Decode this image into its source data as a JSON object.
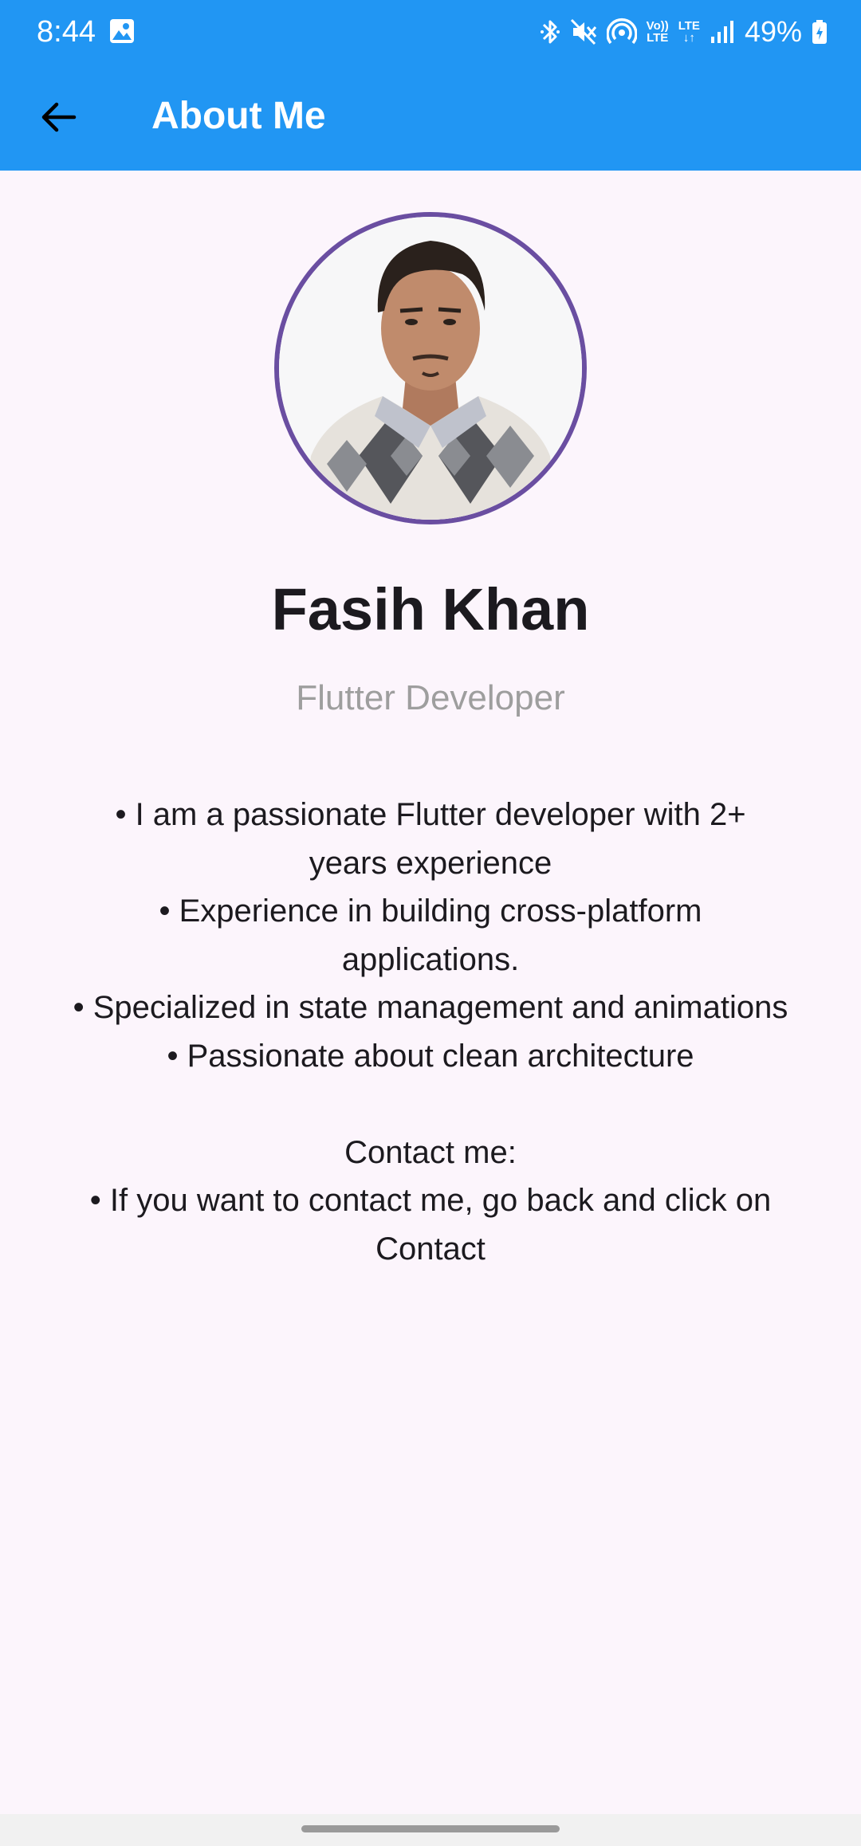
{
  "status_bar": {
    "time": "8:44",
    "volte_top": "Vo))",
    "volte_bottom": "LTE",
    "lte_label": "LTE",
    "battery_percent": "49%",
    "icons": [
      "gallery-icon",
      "bluetooth-icon",
      "vibrate-mute-icon",
      "hotspot-icon",
      "volte-icon",
      "lte-data-icon",
      "signal-icon",
      "battery-charging-icon"
    ]
  },
  "app_bar": {
    "title": "About Me",
    "back_icon": "arrow-back-icon",
    "background": "#2196f3"
  },
  "profile": {
    "name": "Fasih Khan",
    "role": "Flutter Developer",
    "avatar_border_color": "#6a4ea1"
  },
  "bio": {
    "lines": [
      "• I am a passionate Flutter developer with 2+ years experience",
      "• Experience in building cross-platform applications.",
      "• Specialized in state management and animations",
      "• Passionate about clean architecture"
    ],
    "contact_heading": "Contact me:",
    "contact_line": "• If you want to contact me, go back and click on Contact"
  }
}
